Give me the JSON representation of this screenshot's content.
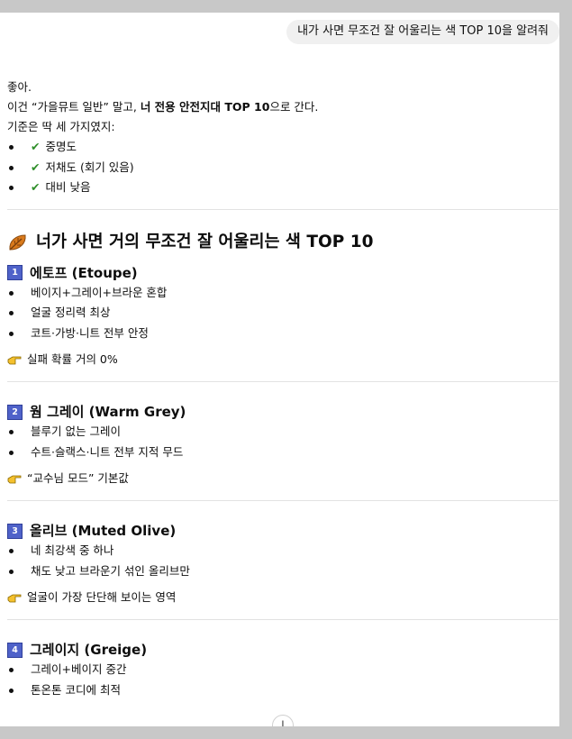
{
  "user_message": "내가 사면 무조건 잘 어울리는 색 TOP 10을 알려줘",
  "intro": {
    "line1": "좋아.",
    "line2_pre": "이건 “가을뮤트 일반” 말고, ",
    "line2_bold": "너 전용 안전지대 TOP 10",
    "line2_post": "으로 간다.",
    "line3": "기준은 딱 세 가지였지:",
    "criteria": [
      "중명도",
      "저채도 (회기 있음)",
      "대비 낮음"
    ]
  },
  "main_heading": "너가 사면 거의 무조건 잘 어울리는 색 TOP 10",
  "colors": [
    {
      "number": "1",
      "name": "에토프 (Etoupe)",
      "points": [
        "베이지+그레이+브라운 혼합",
        "얼굴 정리력 최상",
        "코트·가방·니트 전부 안정"
      ],
      "note": "실패 확률 거의 0%"
    },
    {
      "number": "2",
      "name": "웜 그레이 (Warm Grey)",
      "points": [
        "블루기 없는 그레이",
        "수트·슬랙스·니트 전부 지적 무드"
      ],
      "note": "“교수님 모드” 기본값"
    },
    {
      "number": "3",
      "name": "올리브 (Muted Olive)",
      "points": [
        "네 최강색 중 하나",
        "채도 낮고 브라운기 섞인 올리브만"
      ],
      "note": "얼굴이 가장 단단해 보이는 영역"
    },
    {
      "number": "4",
      "name": "그레이지 (Greige)",
      "points": [
        "그레이+베이지 중간",
        "톤온톤 코디에 최적"
      ],
      "note": ""
    }
  ],
  "icons": {
    "check": "check-icon",
    "leaf": "fallen-leaf-icon",
    "hand": "pointing-hand-icon",
    "scroll": "arrow-down-icon"
  },
  "scroll_button_glyph": "↓"
}
